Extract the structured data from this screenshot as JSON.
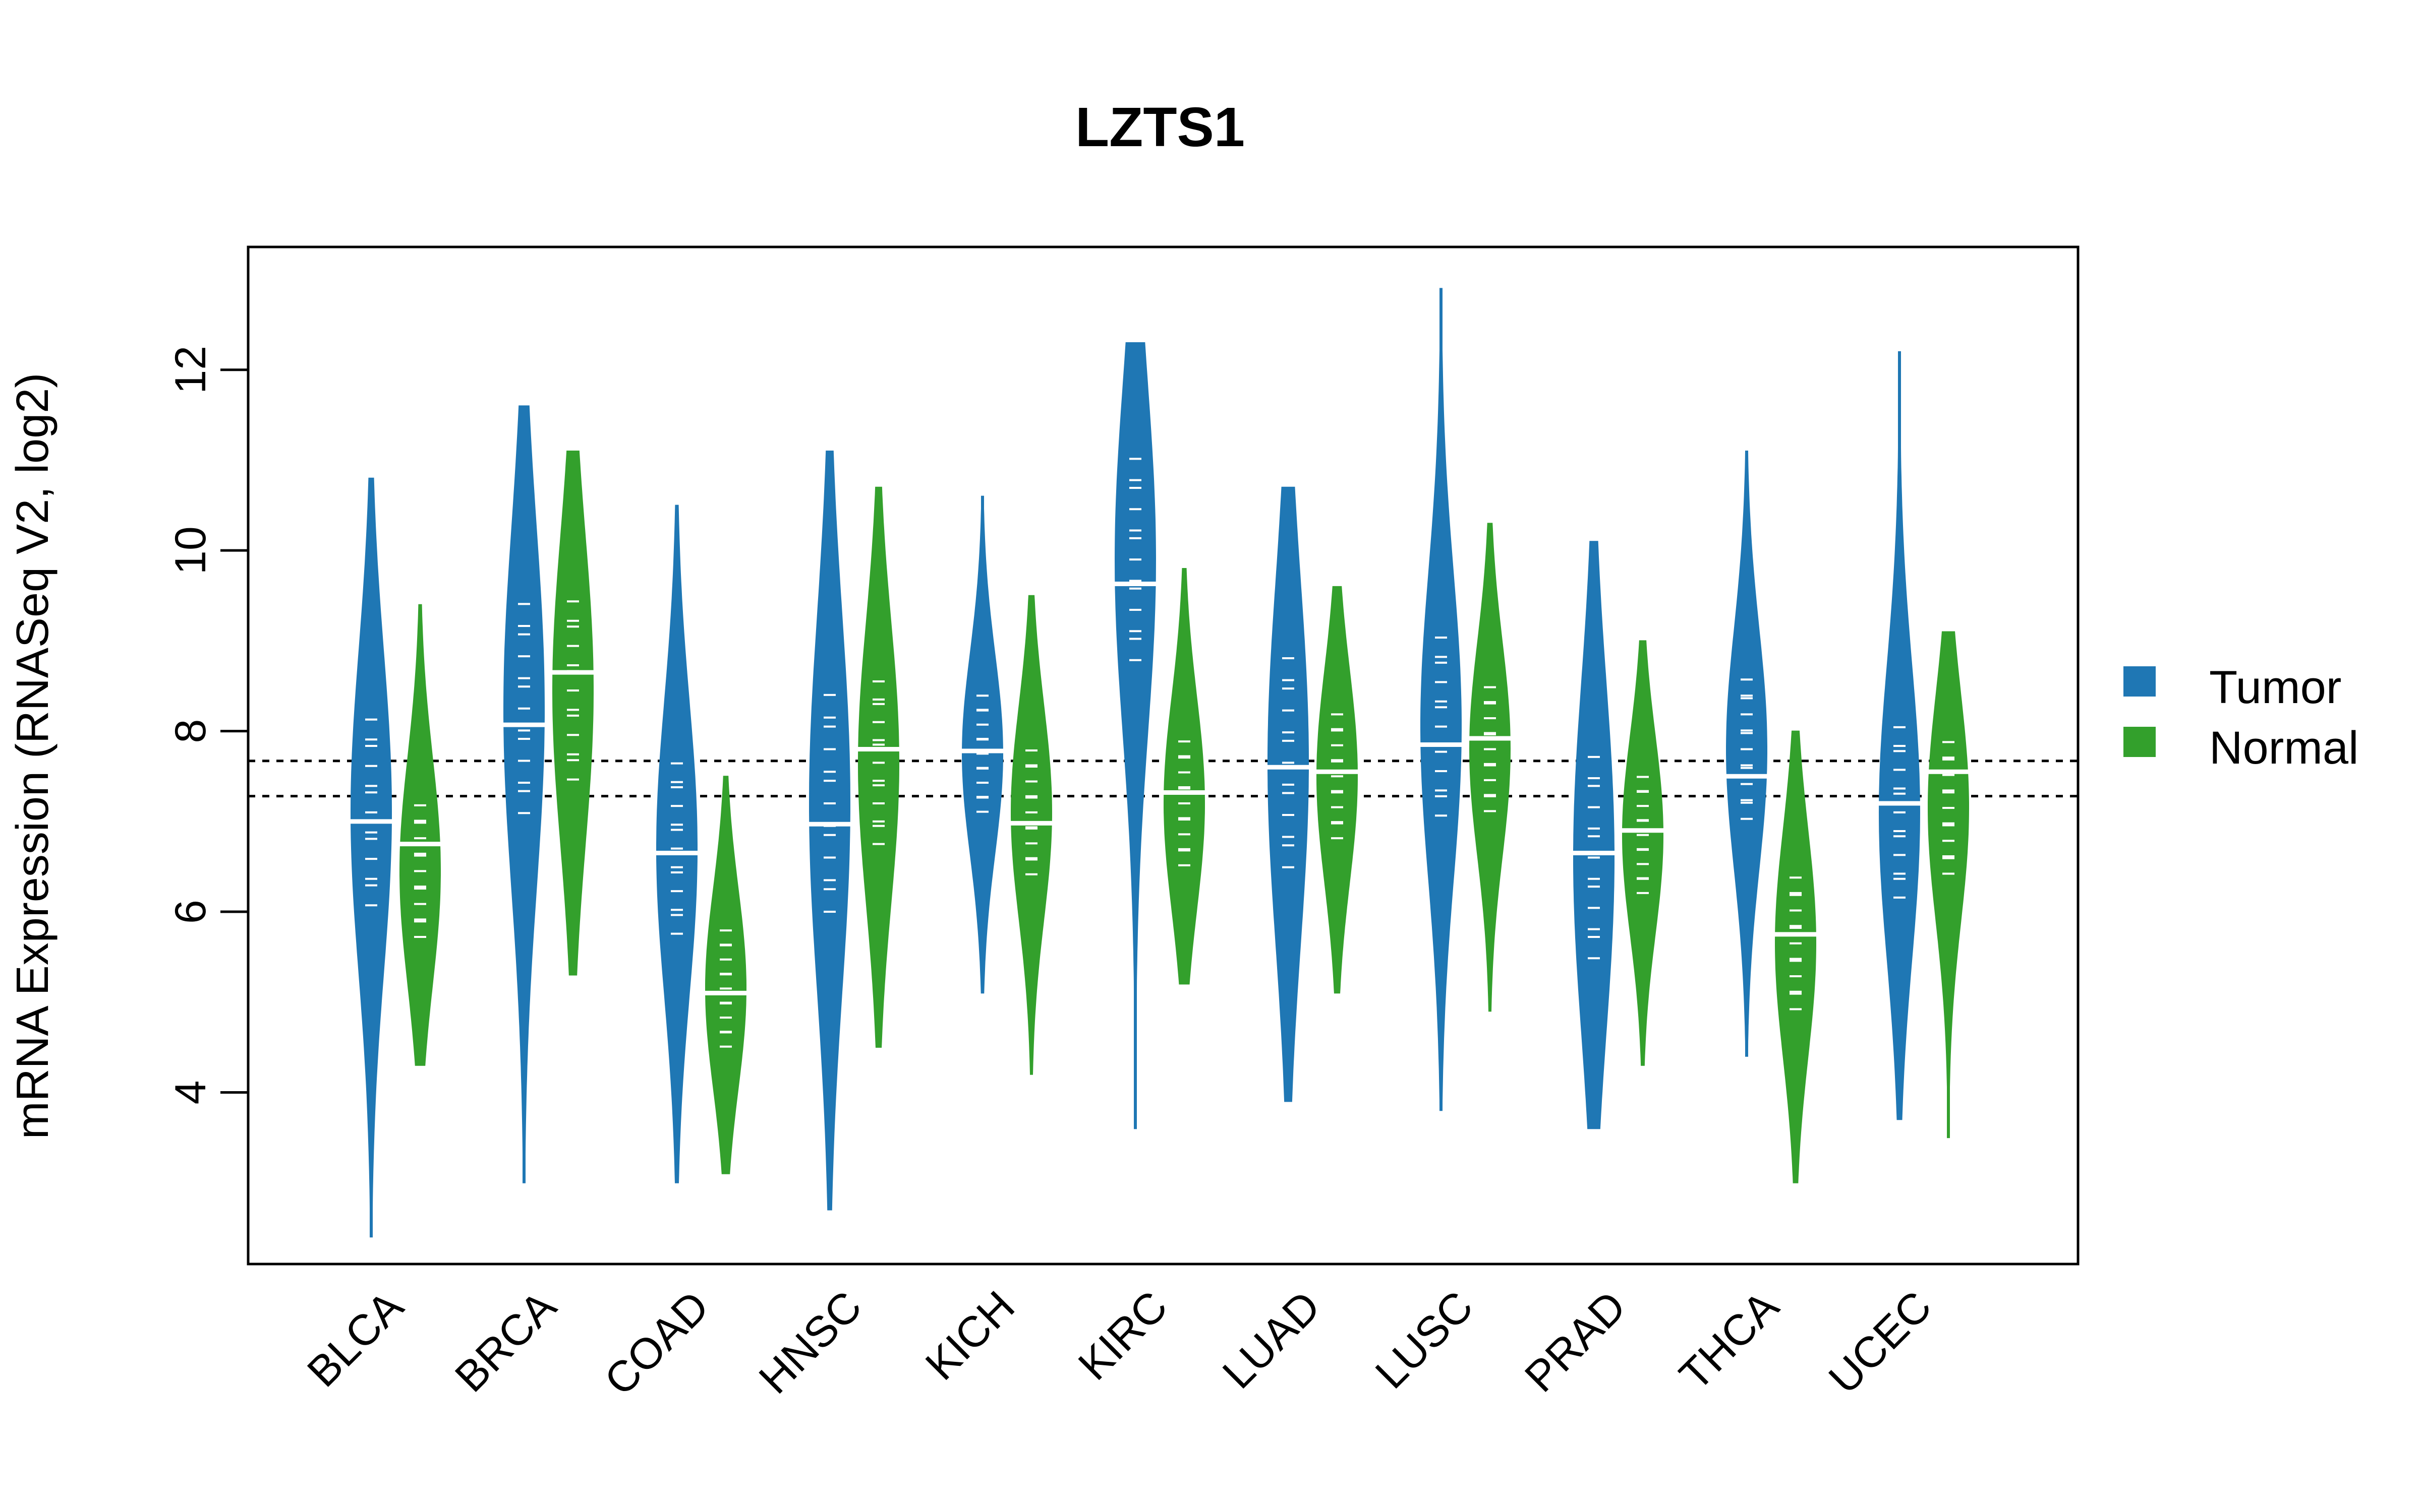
{
  "chart_data": {
    "type": "violin",
    "title": "LZTS1",
    "xlabel": "",
    "ylabel": "mRNA Expression (RNASeq V2, log2)",
    "ylim": [
      2.1,
      13.36
    ],
    "yticks": [
      4,
      6,
      8,
      10,
      12
    ],
    "grid": false,
    "legend_position": "right",
    "reference_lines": [
      7.67,
      7.28
    ],
    "categories": [
      "BLCA",
      "BRCA",
      "COAD",
      "HNSC",
      "KICH",
      "KIRC",
      "LUAD",
      "LUSC",
      "PRAD",
      "THCA",
      "UCEC"
    ],
    "series": [
      {
        "name": "Tumor",
        "color": "#1F77B4",
        "median": [
          7.0,
          8.07,
          6.65,
          6.97,
          7.78,
          9.63,
          7.6,
          7.85,
          6.65,
          7.5,
          7.2
        ],
        "min": [
          2.4,
          3.0,
          3.0,
          2.7,
          5.1,
          3.6,
          3.9,
          3.8,
          3.6,
          4.4,
          3.7
        ],
        "max": [
          10.8,
          11.6,
          10.5,
          11.1,
          10.6,
          12.3,
          10.7,
          12.9,
          10.1,
          11.1,
          12.2
        ],
        "q1": [
          5.9,
          6.9,
          5.6,
          5.8,
          7.0,
          8.6,
          6.3,
          6.9,
          5.3,
          6.9,
          6.0
        ],
        "q3": [
          8.3,
          9.6,
          7.8,
          8.6,
          8.5,
          11.2,
          9.0,
          9.2,
          7.9,
          8.7,
          8.2
        ]
      },
      {
        "name": "Normal",
        "color": "#33A02C",
        "median": [
          6.75,
          8.65,
          5.1,
          7.8,
          6.98,
          7.32,
          7.55,
          7.92,
          6.9,
          5.75,
          7.55
        ],
        "min": [
          4.3,
          5.3,
          3.1,
          4.5,
          4.2,
          5.2,
          5.1,
          4.9,
          4.3,
          3.0,
          3.5
        ],
        "max": [
          9.4,
          11.1,
          7.5,
          10.7,
          9.5,
          9.8,
          9.6,
          10.3,
          9.0,
          8.0,
          9.1
        ],
        "q1": [
          5.6,
          7.3,
          4.4,
          6.6,
          6.3,
          6.4,
          6.7,
          7.0,
          6.1,
          4.8,
          6.3
        ],
        "q3": [
          7.3,
          9.6,
          5.9,
          8.7,
          7.9,
          8.0,
          8.3,
          8.6,
          7.6,
          6.5,
          8.0
        ]
      }
    ]
  }
}
